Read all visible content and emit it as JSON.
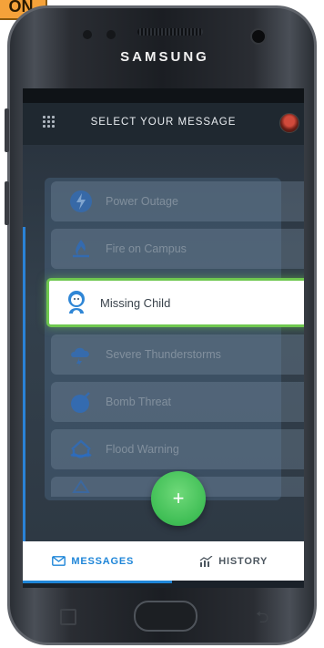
{
  "corner_tag": {
    "text": "ON"
  },
  "device": {
    "brand": "SAMSUNG"
  },
  "app": {
    "title": "SELECT YOUR MESSAGE",
    "icons": {
      "menu": "grid-menu-icon",
      "avatar": "user-avatar"
    }
  },
  "messages": [
    {
      "label": "Power Outage",
      "icon": "lightning-icon"
    },
    {
      "label": "Fire on Campus",
      "icon": "fire-icon"
    },
    {
      "label": "Missing Child",
      "icon": "child-icon",
      "selected": true
    },
    {
      "label": "Severe Thunderstorms",
      "icon": "storm-cloud-icon"
    },
    {
      "label": "Bomb Threat",
      "icon": "bomb-icon"
    },
    {
      "label": "Flood Warning",
      "icon": "flood-house-icon"
    }
  ],
  "fab": {
    "label": "+"
  },
  "tabs": [
    {
      "label": "MESSAGES",
      "icon": "envelope-icon",
      "active": true
    },
    {
      "label": "HISTORY",
      "icon": "chart-icon",
      "active": false
    }
  ],
  "colors": {
    "accent": "#1f86d8",
    "selected_border": "#6fc84f",
    "fab": "#3fbe55",
    "corner_tag": "#f5a23a"
  }
}
